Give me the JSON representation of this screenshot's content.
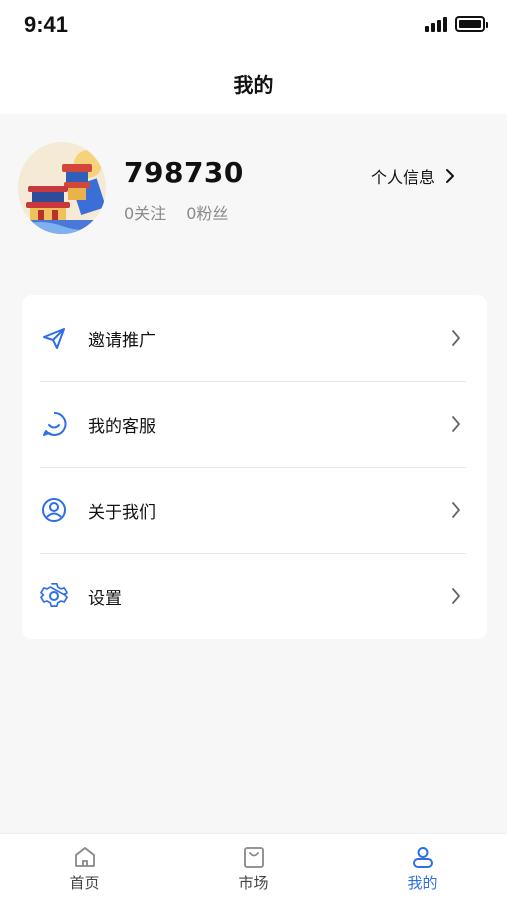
{
  "status_bar": {
    "time": "9:41"
  },
  "header": {
    "title": "我的"
  },
  "profile": {
    "username": "798730",
    "following": "0关注",
    "followers": "0粉丝",
    "info_link": "个人信息"
  },
  "menu": {
    "items": [
      {
        "label": "邀请推广",
        "icon": "paper-plane-icon"
      },
      {
        "label": "我的客服",
        "icon": "chat-smile-icon"
      },
      {
        "label": "关于我们",
        "icon": "user-circle-icon"
      },
      {
        "label": "设置",
        "icon": "gear-icon"
      }
    ]
  },
  "tabbar": {
    "items": [
      {
        "label": "首页",
        "icon": "home-icon",
        "active": false
      },
      {
        "label": "市场",
        "icon": "shopping-bag-icon",
        "active": false
      },
      {
        "label": "我的",
        "icon": "user-icon",
        "active": true
      }
    ]
  },
  "colors": {
    "accent": "#2f6fe4",
    "background": "#f7f7f7",
    "card": "#ffffff"
  }
}
